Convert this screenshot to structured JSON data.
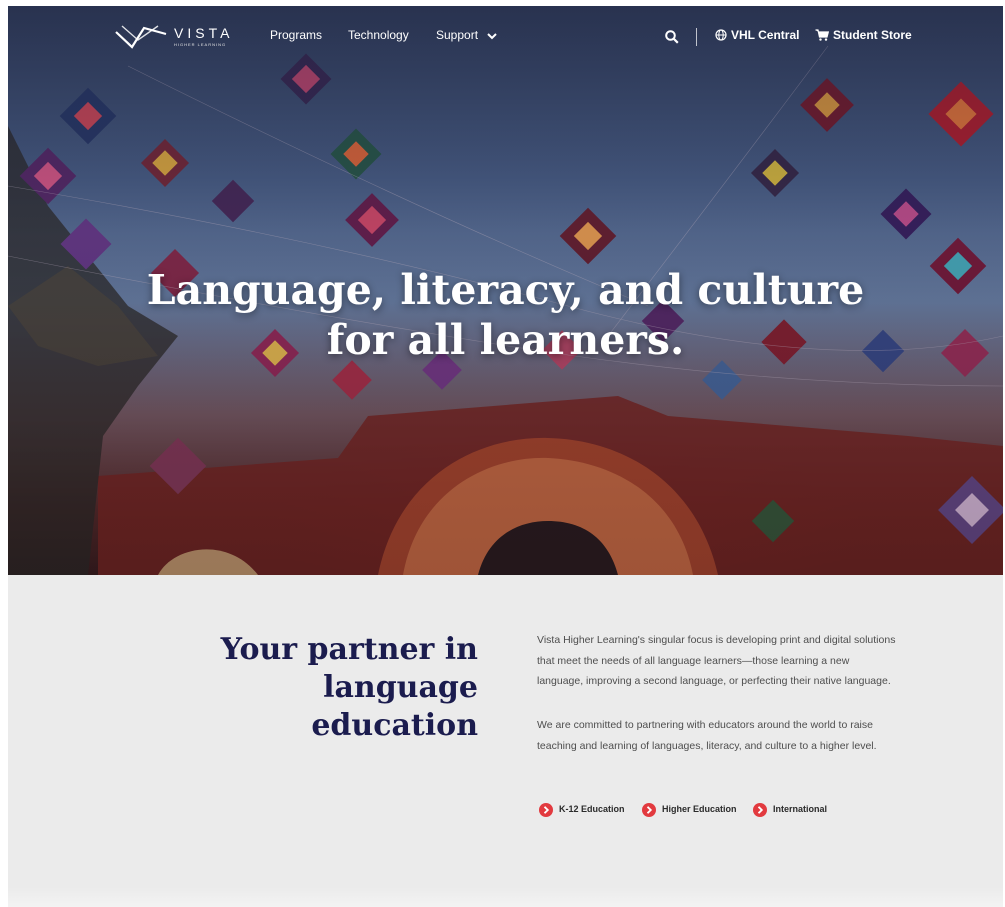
{
  "brand": {
    "name": "VISTA",
    "subtitle": "HIGHER LEARNING"
  },
  "nav": {
    "programs": "Programs",
    "technology": "Technology",
    "support": "Support",
    "vhl_central": "VHL Central",
    "student_store": "Student Store",
    "icons": {
      "search": "search-icon",
      "globe": "globe-icon",
      "cart": "cart-icon",
      "chevron": "chevron-down-icon"
    }
  },
  "hero": {
    "title_line1": "Language, literacy, and culture",
    "title_line2": "for all learners."
  },
  "about": {
    "heading_line1": "Your partner in",
    "heading_line2": "language education",
    "paragraph1": "Vista Higher Learning's singular focus is developing print and digital solutions that meet the needs of all language learners—those learning a new language, improving a second language, or perfecting their native language.",
    "paragraph2": "We are committed to partnering with educators around the world to raise teaching and learning of languages, literacy, and culture to a higher level.",
    "links": [
      {
        "label": "K-12 Education"
      },
      {
        "label": "Higher Education"
      },
      {
        "label": "International"
      }
    ]
  },
  "colors": {
    "heading_navy": "#1b1c4e",
    "accent_red": "#e23a3f",
    "section_bg": "#ebebeb"
  }
}
